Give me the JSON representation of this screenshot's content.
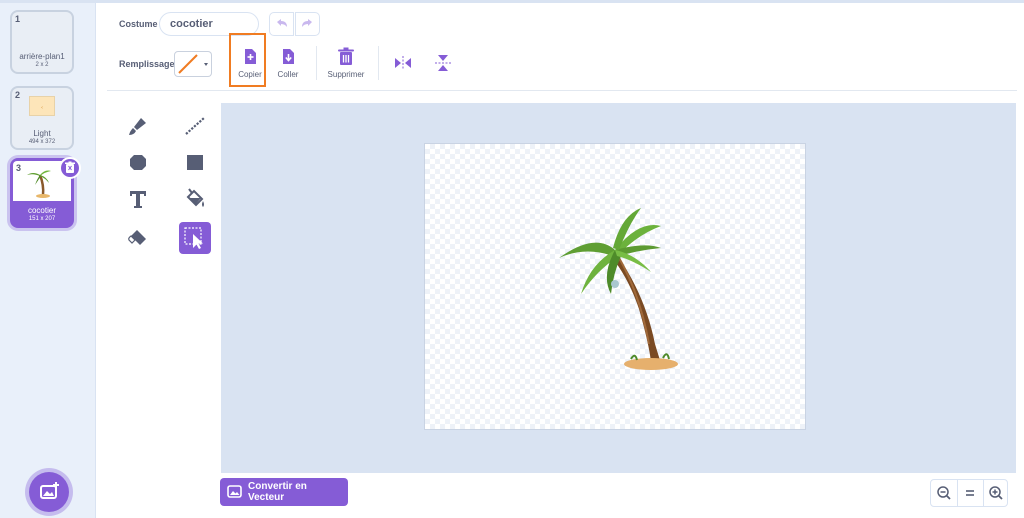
{
  "costumes": [
    {
      "number": "1",
      "name": "arrière-plan1",
      "size": "2 x 2"
    },
    {
      "number": "2",
      "name": "Light",
      "size": "494 x 372"
    },
    {
      "number": "3",
      "name": "cocotier",
      "size": "151 x 207"
    }
  ],
  "editor": {
    "costume_label": "Costume",
    "costume_name": "cocotier",
    "fill_label": "Remplissage",
    "copy_label": "Copier",
    "paste_label": "Coller",
    "delete_label": "Supprimer",
    "convert_label": "Convertir en Vecteur"
  },
  "colors": {
    "accent": "#855cd6",
    "highlight": "#f07c22",
    "fill_line": "#f07c22",
    "tool_icon": "#575e75",
    "canvas_bg": "#d9e3f2"
  },
  "icons": {
    "undo": "undo-icon",
    "redo": "redo-icon",
    "copy": "copy-icon",
    "paste": "paste-icon",
    "delete": "trash-icon",
    "flip_h": "flip-horizontal-icon",
    "flip_v": "flip-vertical-icon",
    "zoom_out": "zoom-out-icon",
    "zoom_reset": "zoom-reset-icon",
    "zoom_in": "zoom-in-icon"
  }
}
